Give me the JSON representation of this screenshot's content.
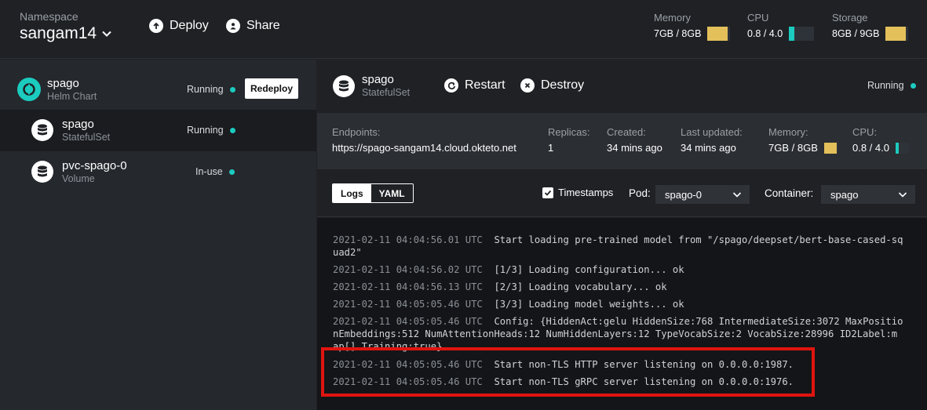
{
  "topbar": {
    "namespace_label": "Namespace",
    "namespace_value": "sangam14",
    "deploy_label": "Deploy",
    "share_label": "Share",
    "resources": [
      {
        "label": "Memory",
        "value": "7GB / 8GB",
        "fill": 0.875,
        "color": "#e3c05a"
      },
      {
        "label": "CPU",
        "value": "0.8 / 4.0",
        "fill": 0.2,
        "color": "#1ccbbf"
      },
      {
        "label": "Storage",
        "value": "8GB / 9GB",
        "fill": 0.89,
        "color": "#e3c05a"
      }
    ]
  },
  "sidebar": {
    "items": [
      {
        "name": "spago",
        "type": "Helm Chart",
        "status": "Running",
        "action": "Redeploy",
        "icon": "helm-chart-icon"
      },
      {
        "name": "spago",
        "type": "StatefulSet",
        "status": "Running",
        "icon": "database-icon"
      },
      {
        "name": "pvc-spago-0",
        "type": "Volume",
        "status": "In-use",
        "icon": "database-icon"
      }
    ]
  },
  "main": {
    "name": "spago",
    "type": "StatefulSet",
    "restart_label": "Restart",
    "destroy_label": "Destroy",
    "status": "Running",
    "details": {
      "endpoints_label": "Endpoints:",
      "endpoints_value": "https://spago-sangam14.cloud.okteto.net",
      "replicas_label": "Replicas:",
      "replicas_value": "1",
      "created_label": "Created:",
      "created_value": "34 mins ago",
      "updated_label": "Last updated:",
      "updated_value": "34 mins ago",
      "memory_label": "Memory:",
      "memory_value": "7GB / 8GB",
      "memory_fill": 0.875,
      "cpu_label": "CPU:",
      "cpu_value": "0.8 / 4.0",
      "cpu_fill": 0.2
    },
    "toolbar": {
      "tab_logs": "Logs",
      "tab_yaml": "YAML",
      "timestamps_label": "Timestamps",
      "timestamps_checked": true,
      "pod_label": "Pod:",
      "pod_value": "spago-0",
      "container_label": "Container:",
      "container_value": "spago"
    },
    "logs": [
      {
        "ts": "2021-02-11 04:04:56.01 UTC",
        "msg": "Start loading pre-trained model from \"/spago/deepset/bert-base-cased-sq",
        "cont": "uad2\""
      },
      {
        "ts": "2021-02-11 04:04:56.02 UTC",
        "msg": "[1/3] Loading configuration... ok"
      },
      {
        "ts": "2021-02-11 04:04:56.13 UTC",
        "msg": "[2/3] Loading vocabulary... ok"
      },
      {
        "ts": "2021-02-11 04:05:05.46 UTC",
        "msg": "[3/3] Loading model weights... ok"
      },
      {
        "ts": "2021-02-11 04:05:05.46 UTC",
        "msg": "Config: {HiddenAct:gelu HiddenSize:768 IntermediateSize:3072 MaxPositio",
        "cont": "nEmbeddings:512 NumAttentionHeads:12 NumHiddenLayers:12 TypeVocabSize:2 VocabSize:28996 ID2Label:m",
        "cont2": "ap[] Training:true}"
      },
      {
        "ts": "2021-02-11 04:05:05.46 UTC",
        "msg": "Start non-TLS HTTP server listening on 0.0.0.0:1987."
      },
      {
        "ts": "2021-02-11 04:05:05.46 UTC",
        "msg": "Start non-TLS gRPC server listening on 0.0.0.0:1976."
      }
    ]
  }
}
